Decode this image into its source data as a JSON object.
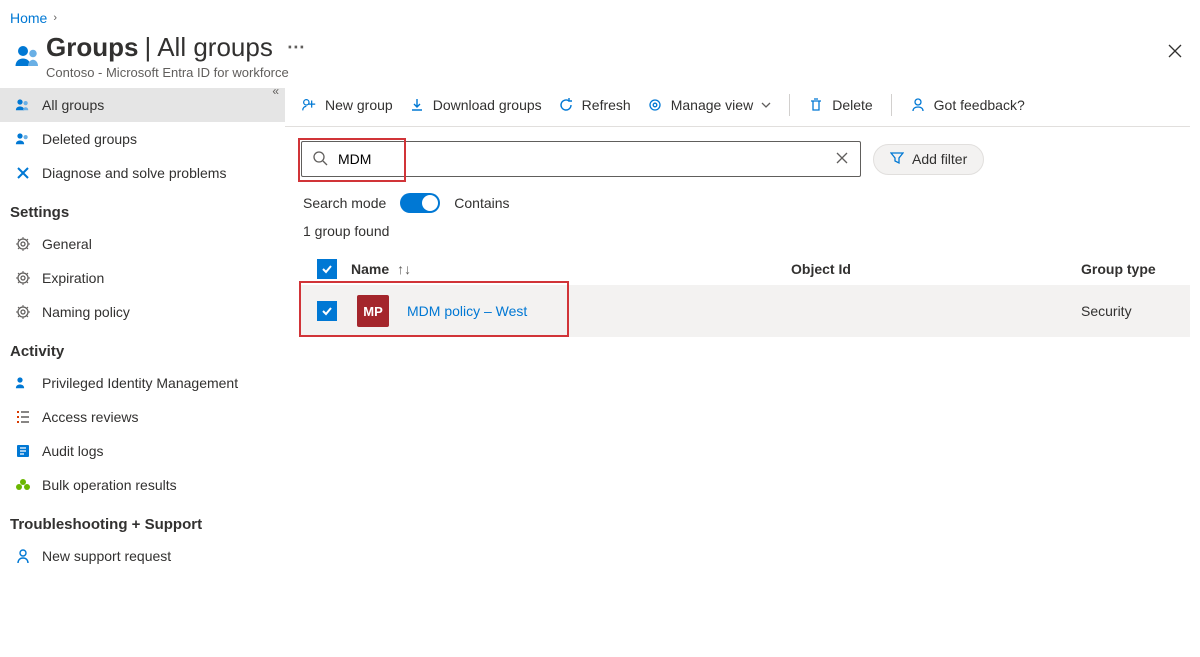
{
  "breadcrumb": {
    "home": "Home"
  },
  "header": {
    "title_left": "Groups",
    "title_right": "All groups",
    "subtitle": "Contoso - Microsoft Entra ID for workforce"
  },
  "sidebar": {
    "items": [
      {
        "label": "All groups"
      },
      {
        "label": "Deleted groups"
      },
      {
        "label": "Diagnose and solve problems"
      }
    ],
    "section_settings": "Settings",
    "settings_items": [
      {
        "label": "General"
      },
      {
        "label": "Expiration"
      },
      {
        "label": "Naming policy"
      }
    ],
    "section_activity": "Activity",
    "activity_items": [
      {
        "label": "Privileged Identity Management"
      },
      {
        "label": "Access reviews"
      },
      {
        "label": "Audit logs"
      },
      {
        "label": "Bulk operation results"
      }
    ],
    "section_support": "Troubleshooting + Support",
    "support_items": [
      {
        "label": "New support request"
      }
    ]
  },
  "toolbar": {
    "new_group": "New group",
    "download": "Download groups",
    "refresh": "Refresh",
    "manage_view": "Manage view",
    "delete": "Delete",
    "feedback": "Got feedback?"
  },
  "search": {
    "value": "MDM",
    "add_filter": "Add filter"
  },
  "mode_row": {
    "label": "Search mode",
    "mode": "Contains"
  },
  "count_text": "1 group found",
  "table": {
    "headers": {
      "name": "Name",
      "object_id": "Object Id",
      "group_type": "Group type"
    },
    "rows": [
      {
        "avatar": "MP",
        "name": "MDM policy – West",
        "object_id": "",
        "group_type": "Security"
      }
    ]
  }
}
